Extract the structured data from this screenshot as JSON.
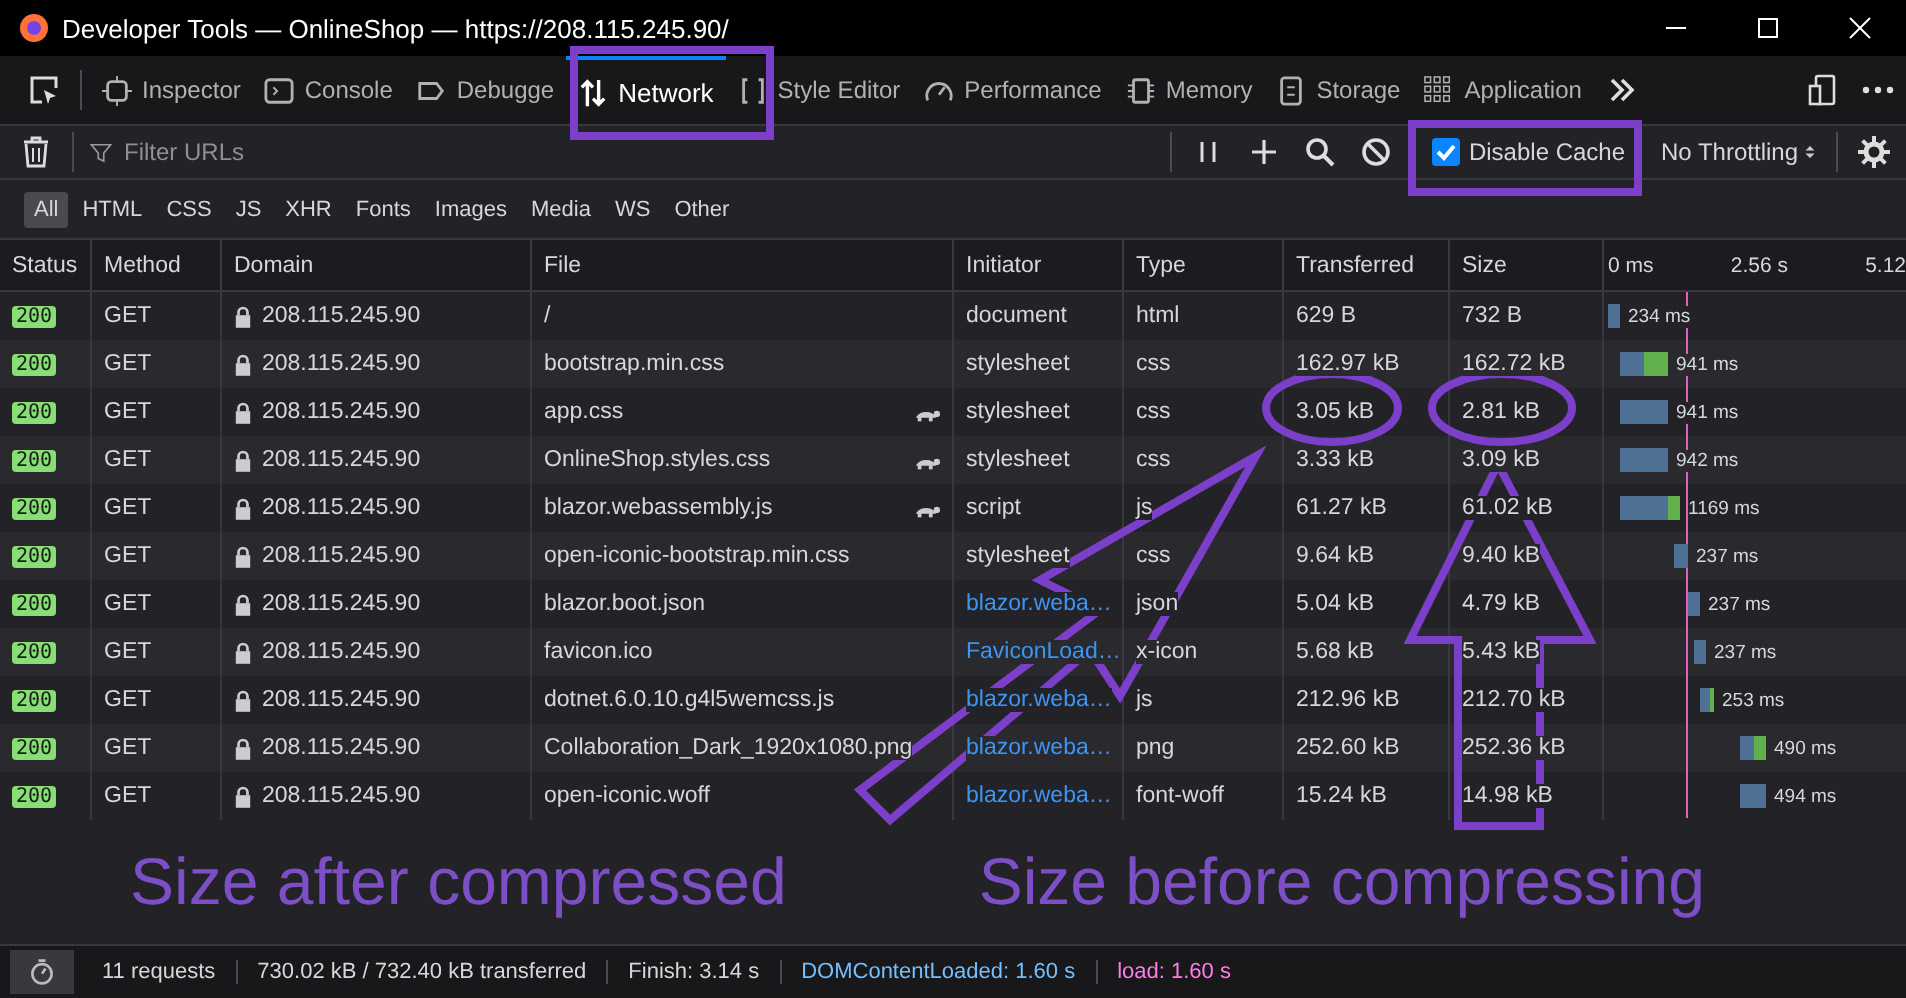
{
  "window": {
    "title": "Developer Tools — OnlineShop — https://208.115.245.90/"
  },
  "tabs": [
    {
      "label": "Inspector",
      "selected": false
    },
    {
      "label": "Console",
      "selected": false
    },
    {
      "label": "Debugge",
      "selected": false
    },
    {
      "label": "Network",
      "selected": true
    },
    {
      "label": "Style Editor",
      "selected": false
    },
    {
      "label": "Performance",
      "selected": false
    },
    {
      "label": "Memory",
      "selected": false
    },
    {
      "label": "Storage",
      "selected": false
    },
    {
      "label": "Application",
      "selected": false
    }
  ],
  "filter": {
    "placeholder": "Filter URLs"
  },
  "disable_cache": {
    "label": "Disable Cache",
    "checked": true
  },
  "throttling": "No Throttling",
  "type_filters": [
    {
      "label": "All",
      "selected": true
    },
    {
      "label": "HTML",
      "selected": false
    },
    {
      "label": "CSS",
      "selected": false
    },
    {
      "label": "JS",
      "selected": false
    },
    {
      "label": "XHR",
      "selected": false
    },
    {
      "label": "Fonts",
      "selected": false
    },
    {
      "label": "Images",
      "selected": false
    },
    {
      "label": "Media",
      "selected": false
    },
    {
      "label": "WS",
      "selected": false
    },
    {
      "label": "Other",
      "selected": false
    }
  ],
  "table": {
    "columns": [
      "Status",
      "Method",
      "Domain",
      "File",
      "Initiator",
      "Type",
      "Transferred",
      "Size"
    ],
    "waterfall_ticks": [
      "0 ms",
      "2.56 s",
      "5.12"
    ],
    "rows": [
      {
        "status": "200",
        "method": "GET",
        "domain": "208.115.245.90",
        "file": "/",
        "slow": false,
        "initiator": "document",
        "initiator_link": false,
        "type": "html",
        "transferred": "629 B",
        "size": "732 B",
        "timing": "234 ms"
      },
      {
        "status": "200",
        "method": "GET",
        "domain": "208.115.245.90",
        "file": "bootstrap.min.css",
        "slow": false,
        "initiator": "stylesheet",
        "initiator_link": false,
        "type": "css",
        "transferred": "162.97 kB",
        "size": "162.72 kB",
        "timing": "941 ms"
      },
      {
        "status": "200",
        "method": "GET",
        "domain": "208.115.245.90",
        "file": "app.css",
        "slow": true,
        "initiator": "stylesheet",
        "initiator_link": false,
        "type": "css",
        "transferred": "3.05 kB",
        "size": "2.81 kB",
        "timing": "941 ms"
      },
      {
        "status": "200",
        "method": "GET",
        "domain": "208.115.245.90",
        "file": "OnlineShop.styles.css",
        "slow": true,
        "initiator": "stylesheet",
        "initiator_link": false,
        "type": "css",
        "transferred": "3.33 kB",
        "size": "3.09 kB",
        "timing": "942 ms"
      },
      {
        "status": "200",
        "method": "GET",
        "domain": "208.115.245.90",
        "file": "blazor.webassembly.js",
        "slow": true,
        "initiator": "script",
        "initiator_link": false,
        "type": "js",
        "transferred": "61.27 kB",
        "size": "61.02 kB",
        "timing": "1169 ms"
      },
      {
        "status": "200",
        "method": "GET",
        "domain": "208.115.245.90",
        "file": "open-iconic-bootstrap.min.css",
        "slow": false,
        "initiator": "stylesheet",
        "initiator_link": false,
        "type": "css",
        "transferred": "9.64 kB",
        "size": "9.40 kB",
        "timing": "237 ms"
      },
      {
        "status": "200",
        "method": "GET",
        "domain": "208.115.245.90",
        "file": "blazor.boot.json",
        "slow": false,
        "initiator": "blazor.weba…",
        "initiator_link": true,
        "type": "json",
        "transferred": "5.04 kB",
        "size": "4.79 kB",
        "timing": "237 ms"
      },
      {
        "status": "200",
        "method": "GET",
        "domain": "208.115.245.90",
        "file": "favicon.ico",
        "slow": false,
        "initiator": "FaviconLoad…",
        "initiator_link": true,
        "type": "x-icon",
        "transferred": "5.68 kB",
        "size": "5.43 kB",
        "timing": "237 ms"
      },
      {
        "status": "200",
        "method": "GET",
        "domain": "208.115.245.90",
        "file": "dotnet.6.0.10.g4l5wemcss.js",
        "slow": false,
        "initiator": "blazor.weba…",
        "initiator_link": true,
        "type": "js",
        "transferred": "212.96 kB",
        "size": "212.70 kB",
        "timing": "253 ms"
      },
      {
        "status": "200",
        "method": "GET",
        "domain": "208.115.245.90",
        "file": "Collaboration_Dark_1920x1080.png",
        "slow": false,
        "initiator": "blazor.weba…",
        "initiator_link": true,
        "type": "png",
        "transferred": "252.60 kB",
        "size": "252.36 kB",
        "timing": "490 ms"
      },
      {
        "status": "200",
        "method": "GET",
        "domain": "208.115.245.90",
        "file": "open-iconic.woff",
        "slow": false,
        "initiator": "blazor.weba…",
        "initiator_link": true,
        "type": "font-woff",
        "transferred": "15.24 kB",
        "size": "14.98 kB",
        "timing": "494 ms"
      }
    ]
  },
  "annotations": {
    "left_caption": "Size after compressed",
    "right_caption": "Size before compressing"
  },
  "status_bar": {
    "requests": "11 requests",
    "transferred": "730.02 kB / 732.40 kB transferred",
    "finish": "Finish: 3.14 s",
    "dom_content_loaded": "DOMContentLoaded: 1.60 s",
    "load": "load: 1.60 s"
  }
}
